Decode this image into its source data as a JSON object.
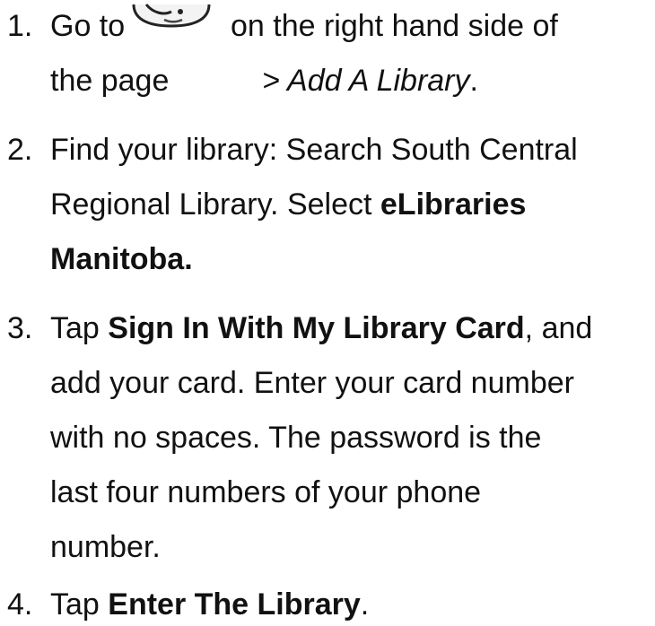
{
  "steps": [
    {
      "number": "1.",
      "line1_a": "Go to",
      "line1_b": "on the right hand side of",
      "line2_a": "the page",
      "line2_b": "> Add A Library",
      "line2_c": "."
    },
    {
      "number": "2.",
      "line1": "Find your library: Search South Central",
      "line2_a": "Regional Library. Select ",
      "line2_b": "eLibraries",
      "line3": "Manitoba."
    },
    {
      "number": "3.",
      "line1_a": "Tap ",
      "line1_b": "Sign In With My Library Card",
      "line1_c": ", and",
      "line2": "add your card. Enter your card number",
      "line3": "with no spaces. The password is the",
      "line4": "last four numbers of your phone",
      "line5": "number."
    },
    {
      "number": "4.",
      "line1_a": "Tap ",
      "line1_b": "Enter The Library",
      "line1_c": "."
    }
  ],
  "icons": {
    "step1_icon": "profile-face-icon"
  }
}
